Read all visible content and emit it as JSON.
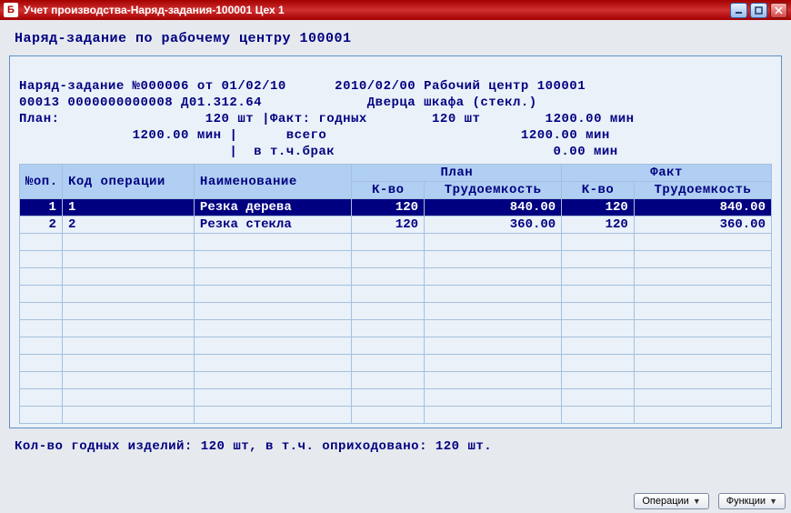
{
  "window": {
    "title": "Учет производства-Наряд-задания-100001 Цех 1",
    "icon_letter": "Б"
  },
  "page_title": "Наряд-задание по рабочему центру 100001",
  "header": {
    "line1_left": "Наряд-задание №000006 от 01/02/10",
    "line1_right": "2010/02/00 Рабочий центр 100001",
    "line2_left": "00013 0000000000008 Д01.312.64",
    "line2_right": "Дверца шкафа (стекл.)",
    "plan_label": "План:",
    "plan_qty": "120 шт",
    "plan_min": "1200.00 мин",
    "fact_good_label": "Факт: годных",
    "fact_good_qty": "120 шт",
    "fact_good_min": "1200.00 мин",
    "fact_total_label": "всего",
    "fact_total_min": "1200.00 мин",
    "fact_reject_label": "в т.ч.брак",
    "fact_reject_min": "0.00 мин"
  },
  "table": {
    "headers": {
      "seq": "№оп.",
      "code": "Код операции",
      "name": "Наименование",
      "plan": "План",
      "fact": "Факт",
      "qty": "К-во",
      "labor": "Трудоемкость"
    },
    "rows": [
      {
        "seq": "1",
        "code": "1",
        "name": "Резка дерева",
        "plan_qty": "120",
        "plan_labor": "840.00",
        "fact_qty": "120",
        "fact_labor": "840.00",
        "selected": true
      },
      {
        "seq": "2",
        "code": "2",
        "name": "Резка стекла",
        "plan_qty": "120",
        "plan_labor": "360.00",
        "fact_qty": "120",
        "fact_labor": "360.00",
        "selected": false
      }
    ]
  },
  "footer_status": "Кол-во годных изделий: 120 шт, в т.ч. оприходовано: 120 шт.",
  "toolbar": {
    "operations": "Операции",
    "functions": "Функции"
  }
}
